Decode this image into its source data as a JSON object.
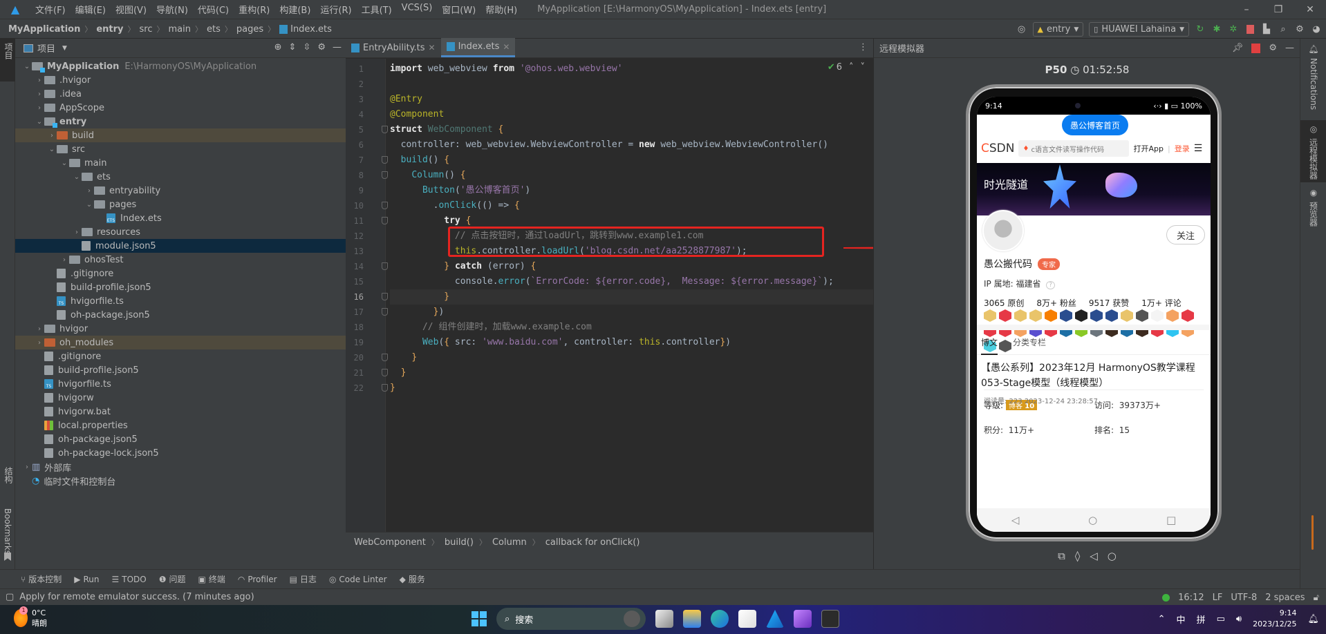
{
  "titlebar": {
    "menu": [
      "文件(F)",
      "编辑(E)",
      "视图(V)",
      "导航(N)",
      "代码(C)",
      "重构(R)",
      "构建(B)",
      "运行(R)",
      "工具(T)",
      "VCS(S)",
      "窗口(W)",
      "帮助(H)"
    ],
    "window_title": "MyApplication [E:\\HarmonyOS\\MyApplication] - Index.ets [entry]",
    "controls": {
      "minimize": "–",
      "restore": "❐",
      "close": "✕"
    }
  },
  "navbar": {
    "breadcrumb": [
      "MyApplication",
      "entry",
      "src",
      "main",
      "ets",
      "pages",
      "Index.ets"
    ],
    "run_config": "entry",
    "device": "HUAWEI Lahaina"
  },
  "project": {
    "title": "项目",
    "tree": [
      {
        "label": "MyApplication",
        "path": "E:\\HarmonyOS\\MyApplication",
        "depth": 0,
        "arrow": "⌄",
        "icon": "module-folder",
        "bold": true
      },
      {
        "label": ".hvigor",
        "depth": 1,
        "arrow": "›",
        "icon": "folder"
      },
      {
        "label": ".idea",
        "depth": 1,
        "arrow": "›",
        "icon": "folder"
      },
      {
        "label": "AppScope",
        "depth": 1,
        "arrow": "›",
        "icon": "folder"
      },
      {
        "label": "entry",
        "depth": 1,
        "arrow": "⌄",
        "icon": "module-folder",
        "bold": true
      },
      {
        "label": "build",
        "depth": 2,
        "arrow": "›",
        "icon": "folder-orange",
        "highlight": "build"
      },
      {
        "label": "src",
        "depth": 2,
        "arrow": "⌄",
        "icon": "folder"
      },
      {
        "label": "main",
        "depth": 3,
        "arrow": "⌄",
        "icon": "folder"
      },
      {
        "label": "ets",
        "depth": 4,
        "arrow": "⌄",
        "icon": "folder"
      },
      {
        "label": "entryability",
        "depth": 5,
        "arrow": "›",
        "icon": "folder"
      },
      {
        "label": "pages",
        "depth": 5,
        "arrow": "⌄",
        "icon": "folder"
      },
      {
        "label": "Index.ets",
        "depth": 6,
        "arrow": "",
        "icon": "ets"
      },
      {
        "label": "resources",
        "depth": 4,
        "arrow": "›",
        "icon": "folder"
      },
      {
        "label": "module.json5",
        "depth": 4,
        "arrow": "",
        "icon": "json",
        "highlight": "selected"
      },
      {
        "label": "ohosTest",
        "depth": 3,
        "arrow": "›",
        "icon": "folder"
      },
      {
        "label": ".gitignore",
        "depth": 2,
        "arrow": "",
        "icon": "ignore"
      },
      {
        "label": "build-profile.json5",
        "depth": 2,
        "arrow": "",
        "icon": "json"
      },
      {
        "label": "hvigorfile.ts",
        "depth": 2,
        "arrow": "",
        "icon": "ts"
      },
      {
        "label": "oh-package.json5",
        "depth": 2,
        "arrow": "",
        "icon": "json"
      },
      {
        "label": "hvigor",
        "depth": 1,
        "arrow": "›",
        "icon": "folder"
      },
      {
        "label": "oh_modules",
        "depth": 1,
        "arrow": "›",
        "icon": "folder-orange",
        "highlight": "build"
      },
      {
        "label": ".gitignore",
        "depth": 1,
        "arrow": "",
        "icon": "ignore"
      },
      {
        "label": "build-profile.json5",
        "depth": 1,
        "arrow": "",
        "icon": "json"
      },
      {
        "label": "hvigorfile.ts",
        "depth": 1,
        "arrow": "",
        "icon": "ts"
      },
      {
        "label": "hvigorw",
        "depth": 1,
        "arrow": "",
        "icon": "shell"
      },
      {
        "label": "hvigorw.bat",
        "depth": 1,
        "arrow": "",
        "icon": "text"
      },
      {
        "label": "local.properties",
        "depth": 1,
        "arrow": "",
        "icon": "properties"
      },
      {
        "label": "oh-package.json5",
        "depth": 1,
        "arrow": "",
        "icon": "json"
      },
      {
        "label": "oh-package-lock.json5",
        "depth": 1,
        "arrow": "",
        "icon": "json"
      },
      {
        "label": "外部库",
        "depth": 0,
        "arrow": "›",
        "icon": "library"
      },
      {
        "label": "临时文件和控制台",
        "depth": 0,
        "arrow": "",
        "icon": "scratch"
      }
    ]
  },
  "left_strip": {
    "project_label": "项目",
    "structure_label": "结构",
    "bookmarks_label": "Bookmarks"
  },
  "editor": {
    "tabs": [
      {
        "label": "EntryAbility.ts",
        "active": false
      },
      {
        "label": "Index.ets",
        "active": true
      }
    ],
    "inspection_count": "6",
    "current_line": 16,
    "lines": [
      "import web_webview from '@ohos.web.webview'",
      "",
      "@Entry",
      "@Component",
      "struct WebComponent {",
      "  controller: web_webview.WebviewController = new web_webview.WebviewController()",
      "  build() {",
      "    Column() {",
      "      Button('愚公博客首页')",
      "        .onClick(() => {",
      "          try {",
      "            // 点击按钮时，通过loadUrl，跳转到www.example1.com",
      "            this.controller.loadUrl('blog.csdn.net/aa2528877987');",
      "          } catch (error) {",
      "            console.error(`ErrorCode: ${error.code},  Message: ${error.message}`);",
      "          }",
      "        })",
      "      // 组件创建时，加载www.example.com",
      "      Web({ src: 'www.baidu.com', controller: this.controller})",
      "    }",
      "  }",
      "}"
    ],
    "breadcrumb": [
      "WebComponent",
      "build()",
      "Column",
      "callback for onClick()"
    ]
  },
  "emulator": {
    "panel_title": "远程模拟器",
    "device_name": "P50",
    "timer": "01:52:58",
    "status_time": "9:14",
    "battery": "100%",
    "web_button_label": "愚公博客首页",
    "csdn": {
      "logo": "CSDN",
      "search_placeholder": "c语言文件读写操作代码",
      "open_app": "打开App",
      "login": "登录",
      "banner_title": "时光隧道",
      "follow_label": "关注",
      "username": "愚公搬代码",
      "badge": "专家",
      "ip_location": "IP 属地:  福建省",
      "stats": [
        "3065 原创",
        "8万+ 粉丝",
        "9517 获赞",
        "1万+ 评论"
      ],
      "medal_colors": [
        "#e9c46a",
        "#e63946",
        "#e9c46a",
        "#e9c46a",
        "#f77f00",
        "#2a4d8f",
        "#222222",
        "#2a4d8f",
        "#2a4d8f",
        "#e9c46a",
        "#555555",
        "#f4f4f4",
        "#f4a261",
        "#e63946",
        "#e63946",
        "#e63946",
        "#f4a261",
        "#5a4fcf",
        "#e63946",
        "#1d6fa5",
        "#8ac926",
        "#6c757d",
        "#3d2b1f",
        "#1d6fa5",
        "#3d2b1f",
        "#e63946",
        "#2ec4f1",
        "#f4a261",
        "#4dd0e1",
        "#555555"
      ],
      "level_label": "等级:",
      "level_value": "博客",
      "level_num": "10",
      "visits_label": "访问:",
      "visits_value": "39373万+",
      "points_label": "积分:",
      "points_value": "11万+",
      "rank_label": "排名:",
      "rank_value": "15",
      "tabs": [
        "博文",
        "分类专栏"
      ],
      "article_title": "【愚公系列】2023年12月 HarmonyOS教学课程 053-Stage模型（线程模型）",
      "article_meta": "阅读量:  223     2023-12-24 23:28:57"
    },
    "nav": {
      "back": "◁",
      "home": "○",
      "recent": "□"
    }
  },
  "right_strip": {
    "notifications": "Notifications",
    "remote_emulator": "远程模拟器",
    "previewer": "预览器"
  },
  "toolwindows": [
    {
      "icon": "⑂",
      "label": "版本控制"
    },
    {
      "icon": "▶",
      "label": "Run"
    },
    {
      "icon": "☰",
      "label": "TODO"
    },
    {
      "icon": "❶",
      "label": "问题"
    },
    {
      "icon": "▣",
      "label": "终端"
    },
    {
      "icon": "◠",
      "label": "Profiler"
    },
    {
      "icon": "▤",
      "label": "日志"
    },
    {
      "icon": "◎",
      "label": "Code Linter"
    },
    {
      "icon": "◆",
      "label": "服务"
    }
  ],
  "statusline": {
    "message": "Apply for remote emulator success. (7 minutes ago)",
    "position": "16:12",
    "line_sep": "LF",
    "encoding": "UTF-8",
    "indent": "2 spaces"
  },
  "taskbar": {
    "weather_temp": "0°C",
    "weather_desc": "晴朗",
    "weather_badge": "1",
    "search_label": "搜索",
    "ime_lang": "中",
    "ime_mode": "拼",
    "time": "9:14",
    "date": "2023/12/25"
  },
  "colors": {
    "accent": "#4a88c7",
    "highlight_box": "#e52420",
    "csdn_red": "#fc5531",
    "web_button": "#0a7cf0"
  }
}
